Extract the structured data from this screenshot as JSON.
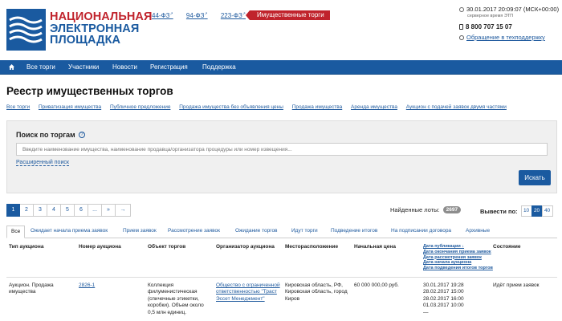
{
  "header": {
    "logo_lines": [
      "НАЦИОНАЛЬНАЯ",
      "ЭЛЕКТРОННАЯ",
      "ПЛОЩАДКА"
    ],
    "law_links": [
      {
        "label": "44-ФЗ"
      },
      {
        "label": "94-ФЗ"
      },
      {
        "label": "223-ФЗ"
      }
    ],
    "active_badge": "Имущественные торги",
    "datetime": "30.01.2017 20:09:07 (МСК+00:00)",
    "server_time_label": "серверное время ЭТП",
    "phone": "8 800 707 15 07",
    "support_link": "Обращение в техподдержку"
  },
  "nav": {
    "items": [
      "Все торги",
      "Участники",
      "Новости",
      "Регистрация",
      "Поддержка"
    ]
  },
  "page_title": "Реестр имущественных торгов",
  "subnav": [
    "Все торги",
    "Приватизация имущества",
    "Публичное предложение",
    "Продажа имущества без объявления цены",
    "Продажа имущества",
    "Аренда имущества",
    "Аукцион с подачей заявок двумя частями"
  ],
  "search": {
    "title": "Поиск по торгам",
    "help": "?",
    "placeholder": "Введите наименование имущества, наименование продавца/организатора процедуры или номер извещения...",
    "advanced_link": "Расширенный поиск",
    "button_label": "Искать"
  },
  "pagination": {
    "pages": [
      "1",
      "2",
      "3",
      "4",
      "5",
      "6",
      "...",
      "»",
      "→"
    ],
    "current": "1"
  },
  "found": {
    "label": "Найденные лоты:",
    "count": "2697"
  },
  "per_page": {
    "label": "Вывести по:",
    "options": [
      "10",
      "20",
      "40"
    ],
    "selected": "20"
  },
  "tabs": [
    "Все",
    "Ожидает начала приема заявок",
    "Прием заявок",
    "Рассмотрение заявок",
    "Ожидание торгов",
    "Идут торги",
    "Подведение итогов",
    "На подписании договора",
    "Архивные"
  ],
  "table": {
    "headers": {
      "type": "Тип аукциона",
      "number": "Номер аукциона",
      "object": "Объект торгов",
      "organizer": "Организатор аукциона",
      "location": "Месторасположение",
      "price": "Начальная цена",
      "state": "Состояние"
    },
    "date_sort_links": [
      "Дата публикации ↓",
      "Дата окончания приема заявок",
      "Дата рассмотрения заявок",
      "Дата начала аукциона",
      "Дата подведения итогов торгов"
    ],
    "rows": [
      {
        "type": "Аукцион. Продажа имущества",
        "number": "2826-1",
        "object": "Коллекция филумениcтическая (спичечные этикетки, коробки). Объем около 0,5 млн единиц.",
        "organizer": "Общество с ограниченной ответственностью \"Траст Эссет Менеджмент\"",
        "location": "Кировская область, РФ, Кировская область, город Киров",
        "price": "60 000 000,00 руб.",
        "dates": [
          "30.01.2017 19:28",
          "28.02.2017 15:00",
          "28.02.2017 16:00",
          "01.03.2017 10:00",
          "—"
        ],
        "state": "Идёт прием заявок"
      }
    ]
  },
  "colors": {
    "brand_blue": "#1a5aa0",
    "brand_red": "#c0232c"
  }
}
